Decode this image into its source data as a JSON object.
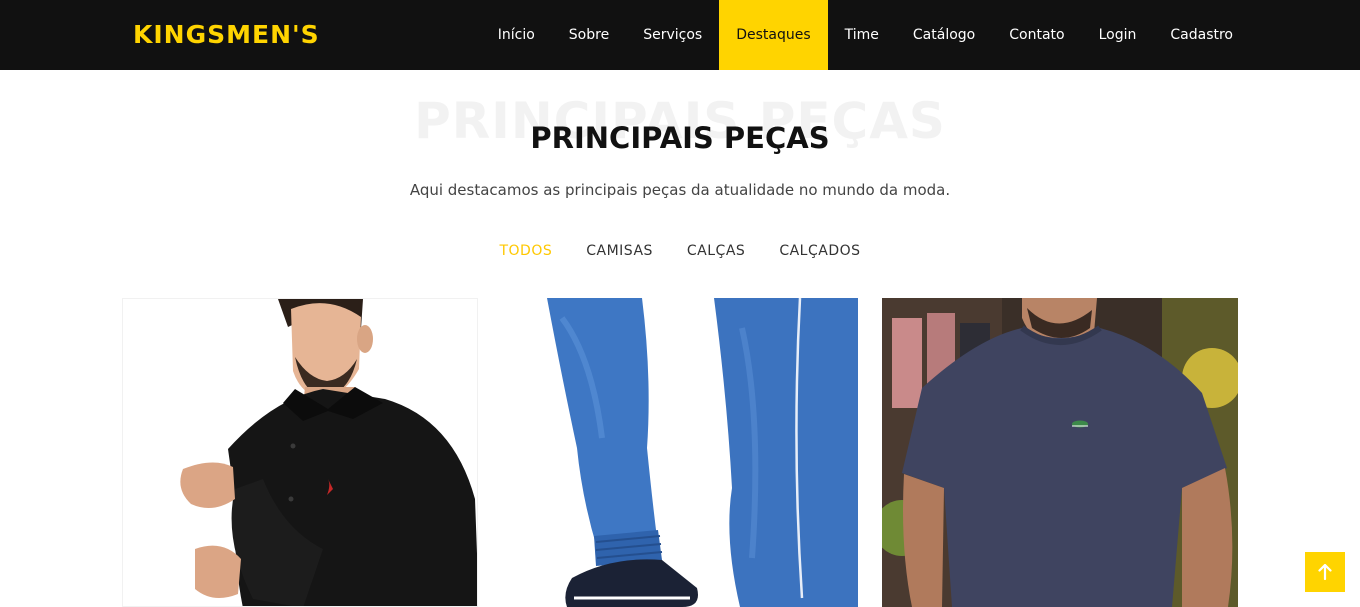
{
  "brand": {
    "name": "KINGSMEN'S",
    "color": "#ffd400"
  },
  "nav": {
    "items": [
      {
        "label": "Início",
        "active": false
      },
      {
        "label": "Sobre",
        "active": false
      },
      {
        "label": "Serviços",
        "active": false
      },
      {
        "label": "Destaques",
        "active": true
      },
      {
        "label": "Time",
        "active": false
      },
      {
        "label": "Catálogo",
        "active": false
      },
      {
        "label": "Contato",
        "active": false
      },
      {
        "label": "Login",
        "active": false
      },
      {
        "label": "Cadastro",
        "active": false
      }
    ]
  },
  "section": {
    "bg_title": "PRINCIPAIS PEÇAS",
    "title": "PRINCIPAIS PEÇAS",
    "subtitle": "Aqui destacamos as principais peças da atualidade no mundo da moda."
  },
  "filters": [
    {
      "label": "TODOS",
      "active": true
    },
    {
      "label": "CAMISAS",
      "active": false
    },
    {
      "label": "CALÇAS",
      "active": false
    },
    {
      "label": "CALÇADOS",
      "active": false
    }
  ],
  "products": [
    {
      "icon": "black-dress-shirt-photo"
    },
    {
      "icon": "blue-jogger-jeans-photo"
    },
    {
      "icon": "navy-tshirt-photo"
    }
  ],
  "back_to_top": {
    "icon": "arrow-up-icon"
  },
  "colors": {
    "accent": "#ffd400",
    "navbar_bg": "#111111",
    "active_filter": "#ffc800"
  }
}
